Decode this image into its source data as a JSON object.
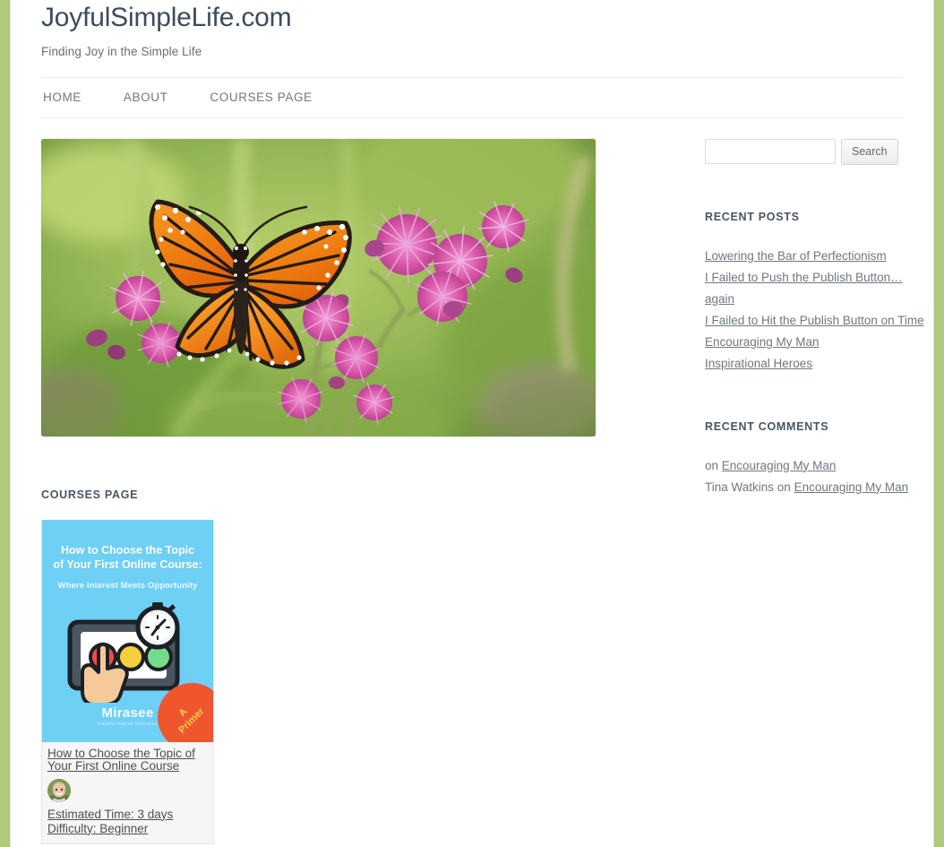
{
  "site": {
    "title": "JoyfulSimpleLife.com",
    "tagline": "Finding Joy in the Simple Life"
  },
  "nav": {
    "items": [
      {
        "label": "HOME"
      },
      {
        "label": "ABOUT"
      },
      {
        "label": "COURSES PAGE"
      }
    ]
  },
  "hero": {
    "alt": "Monarch butterfly on purple ironweed flowers"
  },
  "main": {
    "page_heading": "COURSES PAGE",
    "course": {
      "thumb_title_line1": "How to Choose the Topic",
      "thumb_title_line2": "of Your First Online Course:",
      "thumb_subtitle": "Where Interest Meets Opportunity",
      "brand": "Mirasee",
      "brand_sub": "transformative business",
      "badge_line1": "A",
      "badge_line2": "Primer",
      "title": "How to Choose the Topic of Your First Online Course",
      "estimated_time": "Estimated Time: 3 days",
      "difficulty": "Difficulty: Beginner"
    }
  },
  "sidebar": {
    "search": {
      "value": "",
      "placeholder": "",
      "button_label": "Search"
    },
    "recent_posts": {
      "heading": "RECENT POSTS",
      "items": [
        {
          "label": "Lowering the Bar of Perfectionism"
        },
        {
          "label": "I Failed to Push the Publish Button… again"
        },
        {
          "label": "I Failed to Hit the Publish Button on Time"
        },
        {
          "label": "Encouraging My Man"
        },
        {
          "label": "Inspirational Heroes"
        }
      ]
    },
    "recent_comments": {
      "heading": "RECENT COMMENTS",
      "items": [
        {
          "author": "",
          "connector": "on ",
          "post": "Encouraging My Man"
        },
        {
          "author": "Tina Watkins ",
          "connector": "on ",
          "post": "Encouraging My Man"
        }
      ]
    }
  },
  "colors": {
    "rail_green": "#afc97d",
    "title": "#3d4b5c",
    "link": "#6f7780",
    "thumb_blue": "#6fd0f5",
    "badge_orange": "#f0562d",
    "badge_text": "#ffd24a"
  }
}
